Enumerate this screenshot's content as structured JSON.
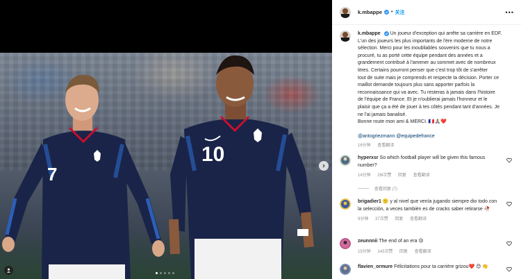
{
  "post": {
    "username": "k.mbappe",
    "follow_label": "关注",
    "more_label": "•••",
    "caption_lines": [
      "Un joueur d'exception qui arrête sa carrière en EDF.",
      "L'un des joueurs les plus importants de l'ère moderne de notre",
      "sélection. Merci pour les inoubliables souvenirs que tu nous a",
      "procuré, tu as porté cette équipe pendant des années et a",
      "grandement contribué à l'amener au sommet avec de nombreux",
      "titres. Certains pourront penser que c'est trop tôt de s'arrêter",
      "tout de suite mais je comprends et respecte ta décision. Porter ce",
      "maillot demande toujours plus sans apporter parfois la",
      "reconnaissance qui va avec. Tu resteras à jamais dans l'histoire",
      "de l'équipe de France. Et je n'oublierai jamais l'honneur et le",
      "plaisir que ça a été de jouer à tes côtés pendant tant d'années. Je",
      "ne l'ai jamais banalisé.",
      "Bonne route mon ami & MERCI. 🇫🇷🙏🏽❤️"
    ],
    "mentions": "@antogriezmann @equipedefrance",
    "time": "16分钟",
    "translate": "查看翻译"
  },
  "comments": [
    {
      "username": "hyperxsr",
      "text": "So which football player will be given this famous number?",
      "time": "14分钟",
      "likes": "26l次赞",
      "reply": "回复",
      "translate": "查看翻译",
      "replies_label": "查看回复 (7)"
    },
    {
      "username": "brigadier1",
      "text": "🙁 y al nivel que venía jugando siempre dio todo con la selección, a veces también es de cracks saber retirarse 🥀",
      "time": "9分钟",
      "likes": "37次赞",
      "reply": "回复",
      "translate": "查看翻译"
    },
    {
      "username": "zeunnnii",
      "text": "The end of an era 😢",
      "time": "15分钟",
      "likes": "143次赞",
      "reply": "回复",
      "translate": "查看翻译"
    },
    {
      "username": "flavien_ormure",
      "text": "Félicitations pour ta carrière grizou❤️ 😊 👏"
    }
  ],
  "media": {
    "jersey_left": "7",
    "jersey_right": "10"
  },
  "colors": {
    "verified": "#3897f0",
    "follow": "#0095f6",
    "mention": "#00376b",
    "jersey": "#1a2448",
    "jersey_stripe": "#2b5fb8"
  },
  "icons": {
    "verified": "verified-badge-icon",
    "heart": "heart-icon",
    "more": "more-icon",
    "next": "chevron-right-icon",
    "tag": "user-tag-icon"
  }
}
